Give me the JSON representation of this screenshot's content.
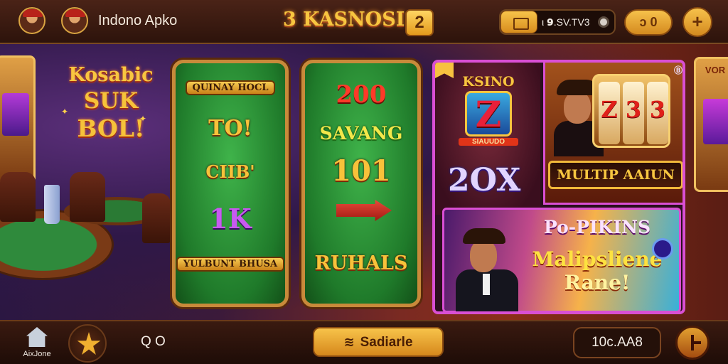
{
  "header": {
    "app_name": "Indono Apko",
    "brand_title": "3 KASNOSI",
    "brand_badge": "2",
    "balance": "ι 𝟵.SV.TV3",
    "refresh_label": "ɔ 0",
    "add_label": "+"
  },
  "scene": {
    "headline": [
      "Kosabic",
      "SUK",
      "BOL!"
    ],
    "left_machine_label": "",
    "right_machine_label": "VOR",
    "card1_games": [
      "QUINAY HOCL",
      "TO!",
      "CIIB'",
      "1K",
      "YULBUNT BHUSA"
    ],
    "card2_games": [
      "200",
      "SAVANG",
      "101",
      "RUHALS"
    ],
    "promo": {
      "casino_title": "KSINO",
      "casino_badge": "Z",
      "casino_caption": "SIAUUDO",
      "multiplier": "2OX",
      "reels": [
        "Z",
        "3",
        "3"
      ],
      "banner": "MULTIP AAIUN",
      "bottom_title": [
        "Po-PIKINS",
        "Malipsliene",
        "Rane!"
      ]
    }
  },
  "footer": {
    "home_label": "AixJone",
    "search_label": "Q O",
    "cta_label": "Sadiarle",
    "amount": "10c.AA8",
    "icons": {
      "home": "home-icon",
      "favorites": "star-icon",
      "cta": "wave-icon",
      "exit": "exit-icon"
    }
  },
  "colors": {
    "gold": "#f7c640",
    "frame_purple": "#d94fd4",
    "felt_green": "#2f9a3c",
    "bar_brown": "#2d130b"
  }
}
